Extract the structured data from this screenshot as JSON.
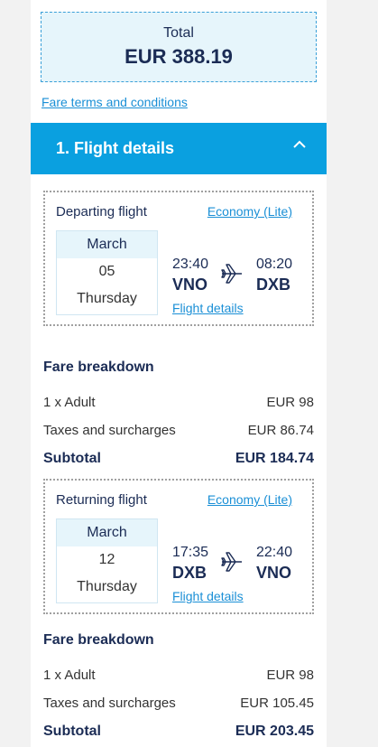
{
  "total": {
    "label": "Total",
    "value": "EUR 388.19"
  },
  "fare_terms_link": "Fare terms and conditions",
  "section": {
    "title": "1. Flight details",
    "chevron": "chevron-up-icon"
  },
  "departing": {
    "title": "Departing flight",
    "class": "Economy (Lite)",
    "month": "March",
    "day": "05",
    "weekday": "Thursday",
    "dep_time": "23:40",
    "dep_code": "VNO",
    "arr_time": "08:20",
    "arr_code": "DXB",
    "details_link": "Flight details",
    "breakdown": {
      "title": "Fare breakdown",
      "rows": [
        {
          "label": "1 x Adult",
          "value": "EUR 98"
        },
        {
          "label": "Taxes and surcharges",
          "value": "EUR 86.74"
        }
      ],
      "subtotal": {
        "label": "Subtotal",
        "value": "EUR 184.74"
      }
    }
  },
  "returning": {
    "title": "Returning flight",
    "class": "Economy (Lite)",
    "month": "March",
    "day": "12",
    "weekday": "Thursday",
    "dep_time": "17:35",
    "dep_code": "DXB",
    "arr_time": "22:40",
    "arr_code": "VNO",
    "details_link": "Flight details",
    "breakdown": {
      "title": "Fare breakdown",
      "rows": [
        {
          "label": "1 x Adult",
          "value": "EUR 98"
        },
        {
          "label": "Taxes and surcharges",
          "value": "EUR 105.45"
        }
      ],
      "subtotal": {
        "label": "Subtotal",
        "value": "EUR 203.45"
      }
    }
  },
  "colors": {
    "accent": "#0aa0e0",
    "link": "#1a8fd6",
    "navy": "#1b2c55",
    "total_bg": "#e6f5fb"
  }
}
